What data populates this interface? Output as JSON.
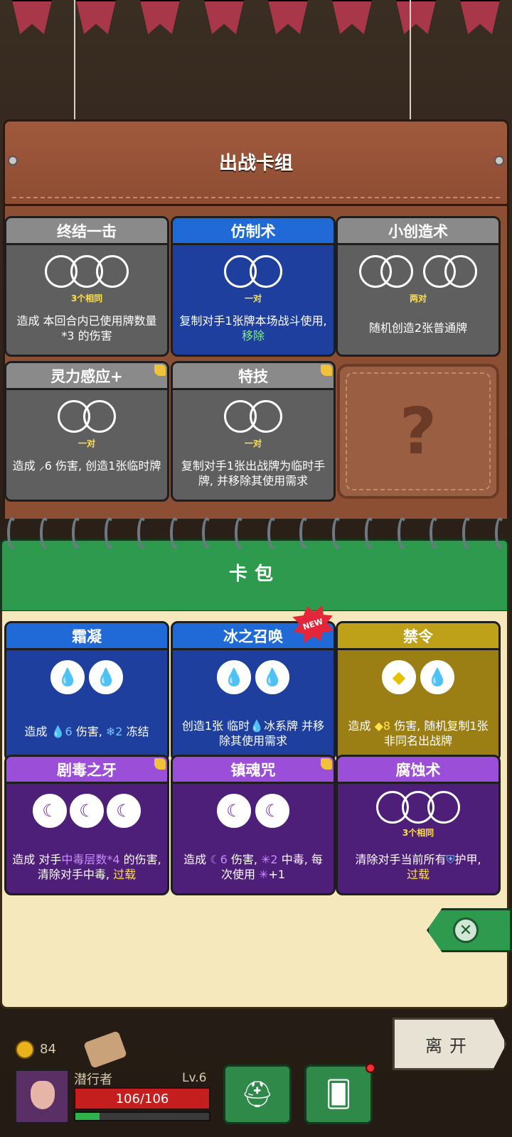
{
  "deck": {
    "title": "出战卡组",
    "cards": [
      {
        "name": "终结一击",
        "requirement": "3个相同",
        "desc": "造成 本回合内已使用牌数量*3 的伤害"
      },
      {
        "name": "仿制术",
        "requirement": "一对",
        "desc_pre": "复制对手1张牌本场战斗使用,",
        "desc_kw": "移除"
      },
      {
        "name": "小创造术",
        "requirement": "两对",
        "desc": "随机创造2张普通牌"
      },
      {
        "name": "灵力感应+",
        "requirement": "一对",
        "desc": "造成 ⸝6 伤害, 创造1张临时牌"
      },
      {
        "name": "特技",
        "requirement": "一对",
        "desc": "复制对手1张出战牌为临时手牌, 并移除其使用需求"
      }
    ],
    "empty_slot_symbol": "?"
  },
  "pack": {
    "title": "卡包",
    "new_badge": "NEW",
    "cards": [
      {
        "name": "霜凝",
        "desc_a": "造成 ",
        "val_a": "6",
        "desc_b": " 伤害, ",
        "val_b": "2",
        "desc_c": " 冻结"
      },
      {
        "name": "冰之召唤",
        "desc": "创造1张 临时💧冰系牌 并移除其使用需求"
      },
      {
        "name": "禁令",
        "desc_a": "造成 ",
        "val_a": "8",
        "desc_b": " 伤害, 随机复制1张非同名出战牌"
      },
      {
        "name": "剧毒之牙",
        "desc_a": "造成 对手",
        "kw": "中毒层数*4",
        "desc_b": " 的伤害, 清除对手中毒,",
        "kw2": " 过载"
      },
      {
        "name": "镇魂咒",
        "desc_a": "造成 ",
        "val_a": "6",
        "desc_b": " 伤害, ",
        "val_b": "2",
        "desc_c": " 中毒, 每次使用 ",
        "desc_d": "+1"
      },
      {
        "name": "腐蚀术",
        "requirement": "3个相同",
        "desc_a": "清除对手当前所有",
        "desc_b": "护甲,",
        "kw": "过载"
      }
    ]
  },
  "hud": {
    "coins": "84",
    "player_name": "潜行者",
    "level": "Lv.6",
    "hp": "106/106",
    "xp_fraction": 0.18,
    "leave_label": "离开"
  }
}
